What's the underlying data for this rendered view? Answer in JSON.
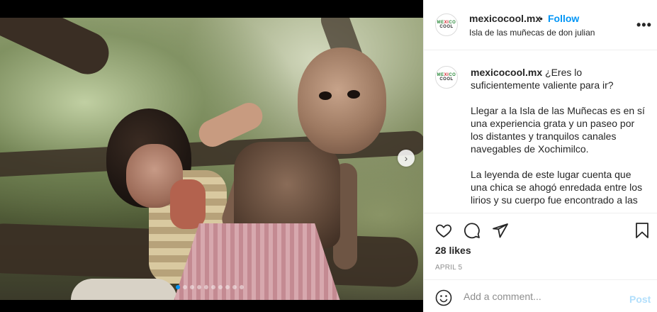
{
  "post": {
    "username": "mexicocool.mx",
    "bullet": "•",
    "follow_label": "Follow",
    "location": "Isla de las muñecas de don julian",
    "more_label": "•••",
    "avatar": {
      "line1_a": "ME",
      "line1_b": "XI",
      "line1_c": "CO",
      "line2": "COOL"
    }
  },
  "caption": {
    "username": "mexicocool.mx",
    "paragraphs": [
      "¿Eres lo suficientemente valiente para ir?",
      "Llegar a la Isla de las Muñecas es en sí una experiencia grata y un paseo por los distantes y tranquilos canales navegables de Xochimilco.",
      "La leyenda de este lugar cuenta que una chica se ahogó enredada entre los lirios y su cuerpo fue encontrado a las"
    ]
  },
  "stats": {
    "likes": "28 likes",
    "date": "APRIL 5"
  },
  "comment": {
    "placeholder": "Add a comment...",
    "post_label": "Post"
  },
  "media": {
    "next_icon": "›",
    "carousel_count": 10,
    "carousel_active": 0
  },
  "colors": {
    "accent": "#0095f6",
    "post_disabled": "#b2dffc",
    "muted": "#8e8e8e",
    "text": "#262626"
  },
  "icons": [
    "heart-icon",
    "comment-icon",
    "share-icon",
    "bookmark-icon",
    "emoji-icon",
    "chevron-right-icon",
    "more-icon"
  ]
}
